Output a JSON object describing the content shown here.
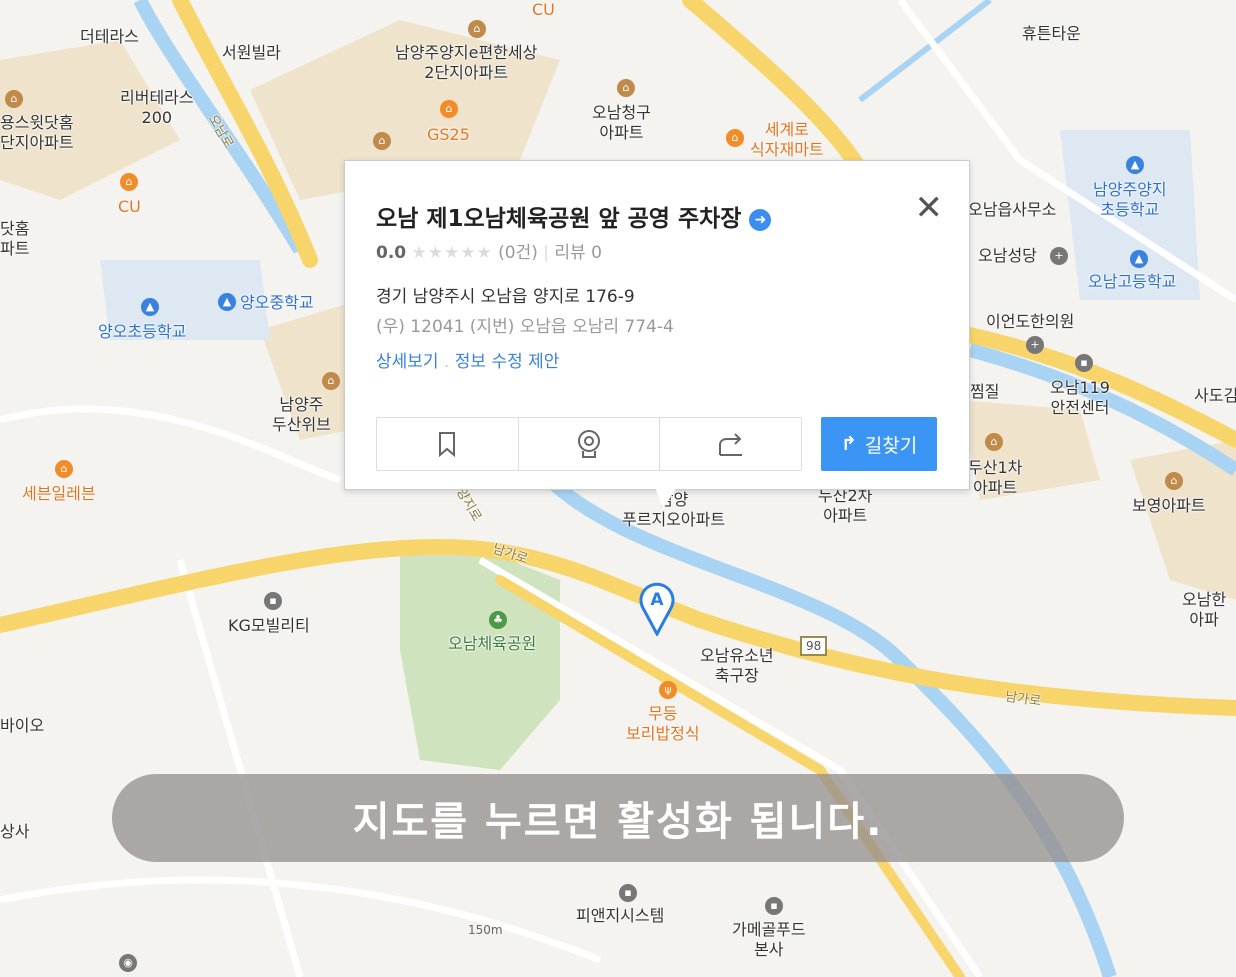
{
  "map": {
    "labels": [
      "더테라스",
      "서원빌라",
      "남양주양지e편한세상\n2단지아파트",
      "오남청구\n아파트",
      "세계로\n식자재마트",
      "휴튼타운",
      "리버테라스\n200",
      "용스윗닷홈\n단지아파트",
      "GS25",
      "CU",
      "CU",
      "닷홈\n파트",
      "남양주양지\n초등학교",
      "오남읍사무소",
      "오남성당",
      "오남고등학교",
      "양오중학교",
      "양오초등학교",
      "이언도한의원",
      "오남119\n안전센터",
      "사도김",
      "찜질",
      "두산1차\n아파트",
      "보영아파트",
      "남양주\n두산위브",
      "세븐일레븐",
      "남양\n푸르지오아파트",
      "두산2차\n아파트",
      "KG모빌리티",
      "오남체육공원",
      "오남유소년\n축구장",
      "무등\n보리밥정식",
      "오남한\n아파",
      "바이오",
      "상사",
      "피앤지시스템",
      "가메골푸드\n본사",
      "남가로",
      "남가로",
      "양지로",
      "오남로"
    ],
    "route_number": "98",
    "scale": "150m",
    "marker_label": "A",
    "colors": {
      "road_yellow": "#f7d56a",
      "water": "#a9d3f2",
      "park": "#cfe3bf",
      "accent": "#3b95f5"
    }
  },
  "popup": {
    "title": "오남 제1오남체육공원 앞 공영 주차장",
    "rating": "0.0",
    "stars": "★★★★★",
    "rating_count": "(0건)",
    "review": "리뷰 0",
    "address": "경기 남양주시 오남읍 양지로 176-9",
    "jibun": "(우) 12041   (지번) 오남읍 오남리 774-4",
    "detail_link": "상세보기",
    "edit_link": "정보 수정 제안",
    "route_button": "길찾기",
    "close": "✕"
  },
  "banner": {
    "text": "지도를 누르면 활성화 됩니다."
  }
}
